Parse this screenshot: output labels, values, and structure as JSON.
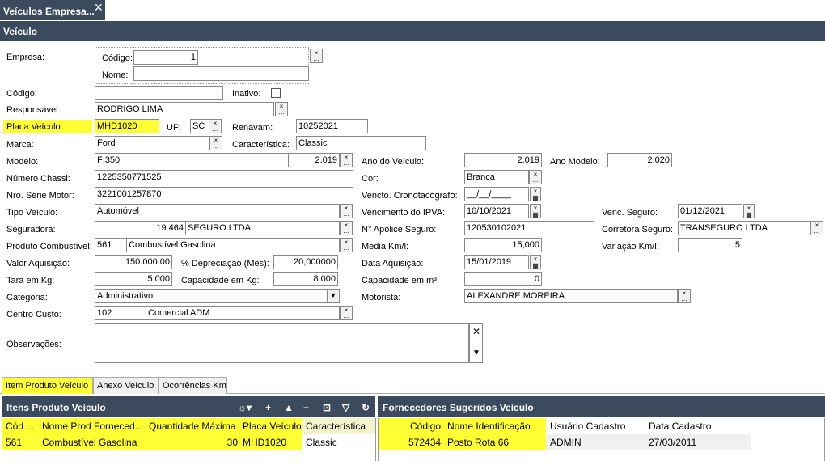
{
  "tab": {
    "label": "Veículos Empresa...",
    "close": "✕"
  },
  "window_title": "Veículo",
  "form": {
    "empresa_label": "Empresa:",
    "empresa_codigo_label": "Código:",
    "empresa_codigo": "1",
    "empresa_nome_label": "Nome:",
    "empresa_nome": "",
    "codigo_label": "Código:",
    "codigo": "",
    "inativo_label": "Inativo:",
    "responsavel_label": "Responsável:",
    "responsavel": "RODRIGO LIMA",
    "placa_label": "Placa Veículo:",
    "placa": "MHD1020",
    "uf_label": "UF:",
    "uf": "SC",
    "renavam_label": "Renavam:",
    "renavam": "10252021",
    "marca_label": "Marca:",
    "marca": "Ford",
    "caracteristica_label": "Característica:",
    "caracteristica": "Classic",
    "modelo_label": "Modelo:",
    "modelo": "F 350",
    "modelo_ano": "2.019",
    "ano_veiculo_label": "Ano do Veículo:",
    "ano_veiculo": "2.019",
    "ano_modelo_label": "Ano Modelo:",
    "ano_modelo": "2.020",
    "chassi_label": "Número Chassi:",
    "chassi": "1225350771525",
    "cor_label": "Cor:",
    "cor": "Branca",
    "serie_motor_label": "Nro. Série Motor:",
    "serie_motor": "3221001257870",
    "cronotacografo_label": "Vencto. Cronotacógrafo:",
    "cronotacografo": "__/__/____",
    "tipo_label": "Tipo Veículo:",
    "tipo": "Automóvel",
    "ipva_label": "Vencimento do IPVA:",
    "ipva": "10/10/2021",
    "venc_seguro_label": "Venc. Seguro:",
    "venc_seguro": "01/12/2021",
    "seguradora_label": "Seguradora:",
    "seguradora_cod": "19.464",
    "seguradora_nome": "SEGURO LTDA",
    "apolice_label": "N° Apólice Seguro:",
    "apolice": "120530102021",
    "corretora_label": "Corretora Seguro:",
    "corretora": "TRANSEGURO LTDA",
    "combustivel_label": "Produto Combustível:",
    "combustivel_cod": "561",
    "combustivel_nome": "Combustível Gasolina",
    "media_label": "Média Km/l:",
    "media": "15,000",
    "variacao_label": "Variação Km/l:",
    "variacao": "5",
    "valor_label": "Valor Aquisição:",
    "valor": "150.000,00",
    "depreciacao_label": "% Depreciação (Mês):",
    "depreciacao": "20,000000",
    "data_aquisicao_label": "Data Aquisição:",
    "data_aquisicao": "15/01/2019",
    "tara_label": "Tara em Kg:",
    "tara": "5.000",
    "capacidade_kg_label": "Capacidade em Kg:",
    "capacidade_kg": "8.000",
    "capacidade_m3_label": "Capacidade em m³:",
    "capacidade_m3": "0",
    "categoria_label": "Categoria:",
    "categoria": "Administrativo",
    "motorista_label": "Motorista:",
    "motorista": "ALEXANDRE MOREIRA",
    "centro_label": "Centro Custo:",
    "centro_cod": "102",
    "centro_nome": "Comercial ADM",
    "obs_label": "Observações:"
  },
  "bottom_tabs": [
    "Item Produto Veículo",
    "Anexo Veículo",
    "Ocorrências Km"
  ],
  "itens_panel": {
    "title": "Itens Produto Veículo",
    "columns": [
      "Cód ...",
      "Nome Prod Forneced...",
      "Quantidade Máxima",
      "Placa Veículo",
      "Característica"
    ],
    "rows": [
      [
        "561",
        "Combustível Gasolina",
        "30",
        "MHD1020",
        "Classic"
      ]
    ]
  },
  "fornecedores_panel": {
    "title": "Fornecedores Sugeridos Veículo",
    "columns": [
      "Código",
      "Nome Identificação",
      "Usuário Cadastro",
      "Data Cadastro"
    ],
    "rows": [
      [
        "572434",
        "Posto Rota 66",
        "ADMIN",
        "27/03/2011"
      ]
    ]
  },
  "colors": {
    "header": "#3c4a5e",
    "highlight": "#ffff33"
  }
}
